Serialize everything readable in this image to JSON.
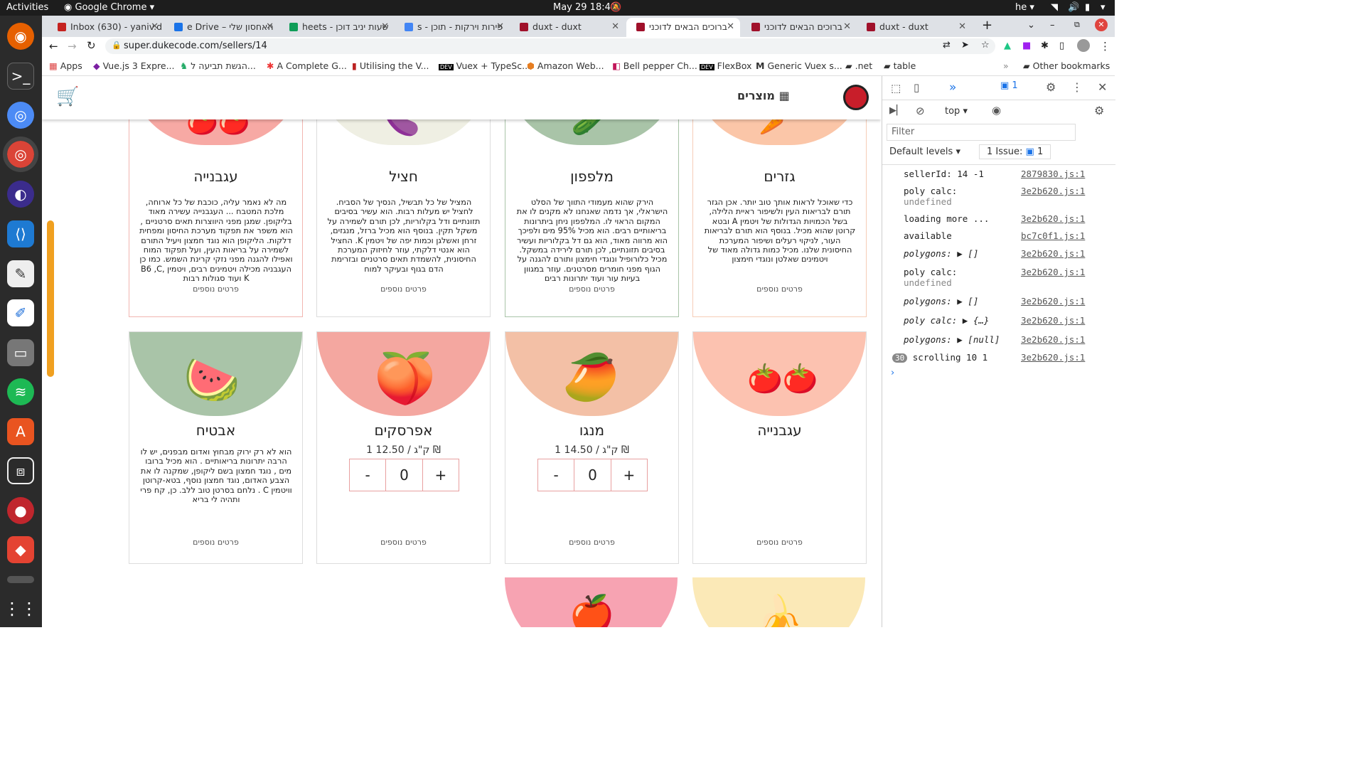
{
  "system": {
    "activities": "Activities",
    "app_name": "Google Chrome",
    "clock": "May 29  18:40",
    "lang": "he"
  },
  "tabs": [
    {
      "label": "Inbox (630) - yaniv.d",
      "color": "#c5221f"
    },
    {
      "label": "e Drive – האחסון שלי",
      "color": "#1a73e8"
    },
    {
      "label": "heets - שעות יניב דוכן",
      "color": "#0f9d58"
    },
    {
      "label": "s - פירות וירקות - תוכן",
      "color": "#4285f4"
    },
    {
      "label": "duxt - duxt",
      "color": "#a0102a"
    },
    {
      "label": "ברוכים הבאים לדוכני",
      "color": "#a0102a"
    },
    {
      "label": "ברוכים הבאים לדוכני",
      "color": "#a0102a"
    },
    {
      "label": "duxt - duxt",
      "color": "#a0102a"
    }
  ],
  "address": {
    "url": "super.dukecode.com/sellers/14"
  },
  "bookmarks": [
    {
      "label": "Apps"
    },
    {
      "label": "Vue.js 3 Expre..."
    },
    {
      "label": "הגשת תביעה ל..."
    },
    {
      "label": "A Complete G..."
    },
    {
      "label": "Utilising the V..."
    },
    {
      "label": "Vuex + TypeSc..."
    },
    {
      "label": "Amazon Web..."
    },
    {
      "label": "Bell pepper Ch..."
    },
    {
      "label": "FlexBox"
    },
    {
      "label": "Generic Vuex s..."
    },
    {
      "label": ".net"
    },
    {
      "label": "table"
    },
    {
      "label": "Other bookmarks"
    }
  ],
  "site": {
    "nav_label": "מוצרים",
    "more_label": "פרטים נוספים"
  },
  "cards_row1": [
    {
      "name": "גזרים",
      "color": "#fbc6a8",
      "desc": "כדי שאוכל לראות אותך טוב יותר. אכן הגזר תורם לבריאות העין ולשיפור ראיית הלילה, בשל הכמויות הגדולות של ויטמין A ובטא קרוטן שהוא מכיל. בנוסף הוא תורם לבריאות העור, לניקוי רעלים ושיפור המערכת החיסונית שלנו. מכיל כמות גדולה מאוד של ויטמינים שאלטן ונוגדי חימצון"
    },
    {
      "name": "מלפפון",
      "color": "#a9c4a8",
      "desc": "הירק שהוא מעמודי התווך של הסלט הישראלי, אך נדמה שאנחנו לא מקנים לו את המקום הראוי לו. המלפפון ניחן ביתרונות בריאותיים רבים. הוא מכיל 95% מים ולפיכך הוא מרווה מאוד, הוא גם דל בקלוריות ועשיר בסיבים תזונתיים, לכן תורם לירידה במשקל. מכיל כלורופיל ונוגדי חימצון ותורם להגנה על הגוף מפני חומרים מסרטנים. עוזר במגוון בעיות עור ועוד יתרונות רבים"
    },
    {
      "name": "חציל",
      "color": "#efefe3",
      "desc": "המציל של כל תבשיל, הנסיך של הסביח. לחציל יש מעלות רבות. הוא עשיר בסיבים תזונתיים ודל בקלוריות, לכן תורם לשמירה על משקל תקין. בנוסף הוא מכיל ברזל, מנגזים, זרחן ואשלגן וכמות יפה של ויטמין K. החציל הוא אנטי דלקתי, עוזר לחיזוק המערכת החיסונית, להשמדת תאים סרטניים ובזרימת הדם בגוף ובעיקר למוח"
    },
    {
      "name": "עגבנייה",
      "color": "#f7a9a4",
      "desc": "מה לא נאמר עליה, כוכבת של כל ארוחה, מלכת המטבח ... העגבנייה עשירה מאוד בליקופן. שמגן מפני היווצרות תאים סרטניים , הוא משפר את תפקוד מערכת החיסון ומפחית דלקות. הליקופן הוא נוגד חמצון ויעיל התורם לשמירה על בריאות העין, ועל תפקוד המוח ואפילו להגנה מפני נזקי קרינת השמש. כמו כן העגבניה מכילה ויטמינים רבים, ויטמין B6 ,C, K ועוד סגולות רבות"
    }
  ],
  "cards_row2": [
    {
      "name": "עגבנייה",
      "color": "#fcc2b0"
    },
    {
      "name": "מנגו",
      "color": "#f3c0a6",
      "price": "1 ק\"ג / 14.50 ₪",
      "qty": "0"
    },
    {
      "name": "אפרסקים",
      "color": "#f4a7a0",
      "price": "1 ק\"ג / 12.50 ₪",
      "qty": "0"
    },
    {
      "name": "אבטיח",
      "color": "#a9c4a8",
      "desc": "הוא לא רק ירוק מבחוץ ואדום מבפנים, יש לו הרבה יתרונות בריאותיים . הוא מכיל ברובו מים , נוגד חמצון בשם ליקופן, שמקנה לו את הצבע האדום, נוגד חמצון נוסף, בטא-קרוטן וויטמין C . נלחם בסרטן טוב ללב. כן, קח פרי ותהיה לי בריא"
    }
  ],
  "cards_row3": [
    {
      "color": "#fbe9b7"
    },
    {
      "color": "#f7a3b2"
    }
  ],
  "devtools": {
    "context": "top",
    "filter_placeholder": "Filter",
    "levels": "Default levels",
    "issues": "1 Issue:",
    "issues_count": "1",
    "badge_count": "1",
    "logs": [
      {
        "text": "sellerId:  14 -1",
        "src": "2879830.js:1"
      },
      {
        "text": "poly calc:",
        "sub": "undefined",
        "src": "3e2b620.js:1"
      },
      {
        "text": "loading more ...",
        "src": "3e2b620.js:1"
      },
      {
        "text": "available",
        "src": "bc7c0f1.js:1"
      },
      {
        "text": "polygons:  ▶ []",
        "src": "3e2b620.js:1"
      },
      {
        "text": "poly calc:",
        "sub": "undefined",
        "src": "3e2b620.js:1"
      },
      {
        "text": "polygons:  ▶ []",
        "src": "3e2b620.js:1"
      },
      {
        "text": "poly calc:  ▶ {…}",
        "src": "3e2b620.js:1"
      },
      {
        "text": "polygons:  ▶ [null]",
        "src": "3e2b620.js:1"
      },
      {
        "text": "scrolling 10 1",
        "src": "3e2b620.js:1",
        "count": "30"
      }
    ]
  }
}
